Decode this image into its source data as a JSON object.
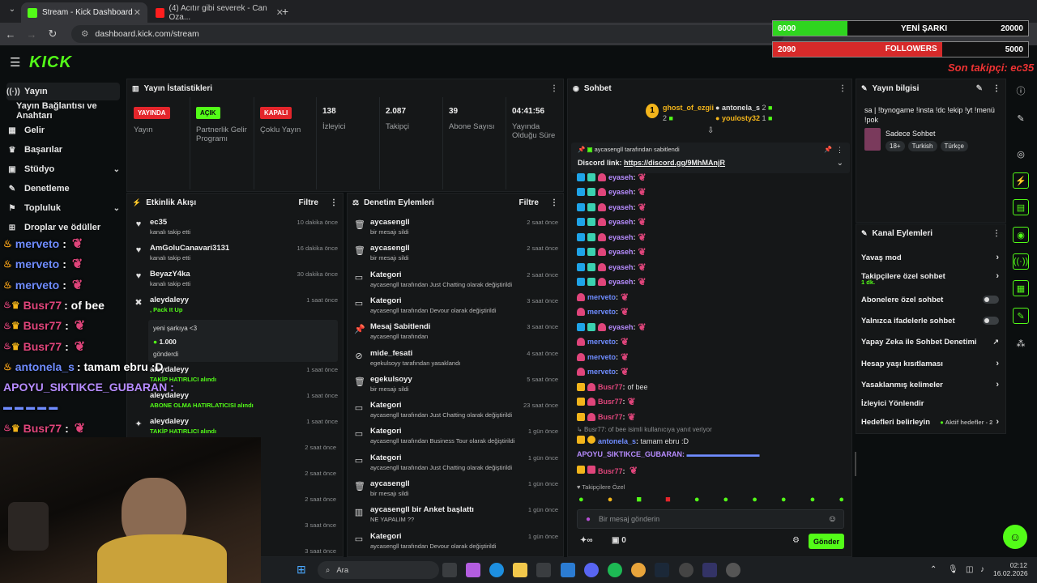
{
  "browser": {
    "tabs": [
      {
        "label": "Stream - Kick Dashboard"
      },
      {
        "label": "(4) Acıtır gibi severek - Can Oza..."
      }
    ],
    "url": "dashboard.kick.com/stream",
    "new_tab": "+"
  },
  "overlay": {
    "bar1": {
      "left": "6000",
      "mid": "YENİ ŞARKI",
      "right": "20000",
      "color": "#2fd51f"
    },
    "bar2": {
      "left": "2090",
      "mid": "FOLLOWERS",
      "right": "5000",
      "color": "#d62a2a"
    },
    "last": "Son takipçi: ec35"
  },
  "kick": {
    "logo": "KICK"
  },
  "sidebar": {
    "items": [
      {
        "label": "Yayın"
      },
      {
        "label": "Yayın Bağlantısı ve Anahtarı"
      },
      {
        "label": "Gelir"
      },
      {
        "label": "Başarılar"
      },
      {
        "label": "Stüdyo"
      },
      {
        "label": "Denetleme"
      },
      {
        "label": "Topluluk"
      },
      {
        "label": "Droplar ve ödüller"
      }
    ]
  },
  "stats": {
    "title": "Yayın İstatistikleri",
    "items": [
      {
        "badge": "YAYINDA",
        "label": "Yayın"
      },
      {
        "badge": "AÇIK",
        "label": "Partnerlik Gelir Programı"
      },
      {
        "badge": "KAPALI",
        "label": "Çoklu Yayın"
      },
      {
        "value": "138",
        "label": "İzleyici"
      },
      {
        "value": "2.087",
        "label": "Takipçi"
      },
      {
        "value": "39",
        "label": "Abone Sayısı"
      },
      {
        "value": "04:41:56",
        "label": "Yayında Olduğu Süre"
      }
    ]
  },
  "activity": {
    "title": "Etkinlik Akışı",
    "filter": "Filtre",
    "items": [
      {
        "name": "ec35",
        "sub": "kanalı takip etti",
        "time": "10 dakika önce"
      },
      {
        "name": "AmGoluCanavari3131",
        "sub": "kanalı takip etti",
        "time": "16 dakika önce"
      },
      {
        "name": "BeyazY4ka",
        "sub": "kanalı takip etti",
        "time": "30 dakika önce"
      },
      {
        "name": "aleydaleyy",
        "sub": ", Pack It Up",
        "time": "1 saat önce"
      },
      {
        "name": "aleydaleyy",
        "sub": "TAKİP HATIRLICI alındı",
        "time": "1 saat önce"
      },
      {
        "name": "aleydaleyy",
        "sub": "ABONE OLMA HATIRLATICISI alındı",
        "time": "1 saat önce"
      },
      {
        "name": "aleydaleyy",
        "sub": "TAKİP HATIRLICI alındı",
        "time": "1 saat önce"
      }
    ],
    "card": {
      "msg": "yeni şarkıya <3",
      "amount": "1.000",
      "sent": "gönderdi"
    },
    "times_more": [
      "2 saat önce",
      "2 saat önce",
      "2 saat önce",
      "3 saat önce",
      "3 saat önce"
    ]
  },
  "moderation": {
    "title": "Denetim Eylemleri",
    "filter": "Filtre",
    "items": [
      {
        "title": "aycasengll",
        "sub": "bir mesajı sildi",
        "time": "2 saat önce"
      },
      {
        "title": "aycasengll",
        "sub": "bir mesajı sildi",
        "time": "2 saat önce"
      },
      {
        "title": "Kategori",
        "sub": "aycasengll tarafından Just Chatting olarak değiştirildi",
        "time": "2 saat önce"
      },
      {
        "title": "Kategori",
        "sub": "aycasengll tarafından Devour olarak değiştirildi",
        "time": "3 saat önce"
      },
      {
        "title": "Mesaj Sabitlendi",
        "sub": "aycasengll tarafından",
        "time": "3 saat önce"
      },
      {
        "title": "mide_fesati",
        "sub": "egekulsoyy tarafından yasaklandı",
        "time": "4 saat önce"
      },
      {
        "title": "egekulsoyy",
        "sub": "bir mesajı sildi",
        "time": "5 saat önce"
      },
      {
        "title": "Kategori",
        "sub": "aycasengll tarafından Just Chatting olarak değiştirildi",
        "time": "23 saat önce"
      },
      {
        "title": "Kategori",
        "sub": "aycasengll tarafından Business Tour olarak değiştirildi",
        "time": "1 gün önce"
      },
      {
        "title": "Kategori",
        "sub": "aycasengll tarafından Just Chatting olarak değiştirildi",
        "time": "1 gün önce"
      },
      {
        "title": "aycasengll",
        "sub": "bir mesajı sildi",
        "time": "1 gün önce"
      },
      {
        "title": "aycasengll bir Anket başlattı",
        "sub": "NE YAPALIM ??",
        "time": "1 gün önce"
      },
      {
        "title": "Kategori",
        "sub": "aycasengll tarafından Devour olarak değiştirildi",
        "time": "1 gün önce"
      }
    ]
  },
  "chat": {
    "title": "Sohbet",
    "top": [
      {
        "name": "ghost_of_ezgii",
        "count": "2"
      },
      {
        "name": "antonela_s",
        "count": "2"
      },
      {
        "name": "youlosty32",
        "count": "1"
      }
    ],
    "pinned": {
      "by": "aycasengll tarafından sabitlendi",
      "text": "Discord link:",
      "link": "https://discord.gg/9MhMAnjR"
    },
    "lines": [
      {
        "user": "eyaseh",
        "color": "#b78cff"
      },
      {
        "user": "eyaseh",
        "color": "#b78cff"
      },
      {
        "user": "eyaseh",
        "color": "#b78cff"
      },
      {
        "user": "eyaseh",
        "color": "#b78cff"
      },
      {
        "user": "eyaseh",
        "color": "#b78cff"
      },
      {
        "user": "eyaseh",
        "color": "#b78cff"
      },
      {
        "user": "eyaseh",
        "color": "#b78cff"
      },
      {
        "user": "eyaseh",
        "color": "#b78cff"
      },
      {
        "user": "merveto",
        "color": "#6f8cff"
      },
      {
        "user": "merveto",
        "color": "#6f8cff"
      },
      {
        "user": "eyaseh",
        "color": "#b78cff"
      },
      {
        "user": "merveto",
        "color": "#6f8cff"
      },
      {
        "user": "merveto",
        "color": "#6f8cff"
      },
      {
        "user": "merveto",
        "color": "#6f8cff"
      },
      {
        "user": "Busr77",
        "color": "#e0457b",
        "msg": "of bee"
      },
      {
        "user": "Busr77",
        "color": "#e0457b"
      },
      {
        "user": "Busr77",
        "color": "#e0457b"
      }
    ],
    "reply": "Busr77: of bee isimli kullanıcıya yanıt veriyor",
    "antonela": {
      "user": "antonela_s",
      "msg": "tamam ebru :D"
    },
    "apoyu": "APOYU_SIKTIKCE_GUBARAN:",
    "lastuser": "Busr77",
    "followers_only": "Takipçilere Özel",
    "placeholder": "Bir mesaj gönderin",
    "count": "0",
    "send": "Gönder"
  },
  "overlay_chat": [
    {
      "user": "merveto",
      "color": "#6f8cff"
    },
    {
      "user": "merveto",
      "color": "#6f8cff"
    },
    {
      "user": "merveto",
      "color": "#6f8cff"
    },
    {
      "user": "Busr77",
      "color": "#e0457b",
      "msg": ": of bee"
    },
    {
      "user": "Busr77",
      "color": "#e0457b"
    },
    {
      "user": "Busr77",
      "color": "#e0457b"
    },
    {
      "user": "antonela_s",
      "color": "#6f8cff",
      "msg": ": tamam ebru :D"
    },
    {
      "user": "APOYU_SIKTIKCE_GUBARAN :",
      "color": "#b78cff"
    },
    {
      "user": "",
      "color": "#e0457b"
    },
    {
      "user": "Busr77",
      "color": "#e0457b"
    }
  ],
  "info": {
    "title": "Yayın bilgisi",
    "text": "sa | !bynogame !insta !dc !ekip !yt !menü !pok",
    "category": "Sadece Sohbet",
    "tags": [
      "18+",
      "Turkish",
      "Türkçe"
    ]
  },
  "channel": {
    "title": "Kanal Eylemleri",
    "items": [
      {
        "label": "Yavaş mod",
        "type": "arrow"
      },
      {
        "label": "Takipçilere özel sohbet",
        "sub": "1 dk.",
        "type": "arrow"
      },
      {
        "label": "Abonelere özel sohbet",
        "type": "toggle"
      },
      {
        "label": "Yalnızca ifadelerle sohbet",
        "type": "toggle"
      },
      {
        "label": "Yapay Zeka ile Sohbet Denetimi",
        "type": "ext"
      },
      {
        "label": "Hesap yaşı kısıtlaması",
        "type": "arrow"
      },
      {
        "label": "Yasaklanmış kelimeler",
        "type": "arrow"
      },
      {
        "label": "İzleyici Yönlendir",
        "type": "none"
      },
      {
        "label": "Hedefleri belirleyin",
        "sub": "Aktif hedefler - 2",
        "type": "arrow"
      }
    ]
  },
  "taskbar": {
    "search": "Ara",
    "time": "02:12",
    "date": "16.02.2026"
  }
}
